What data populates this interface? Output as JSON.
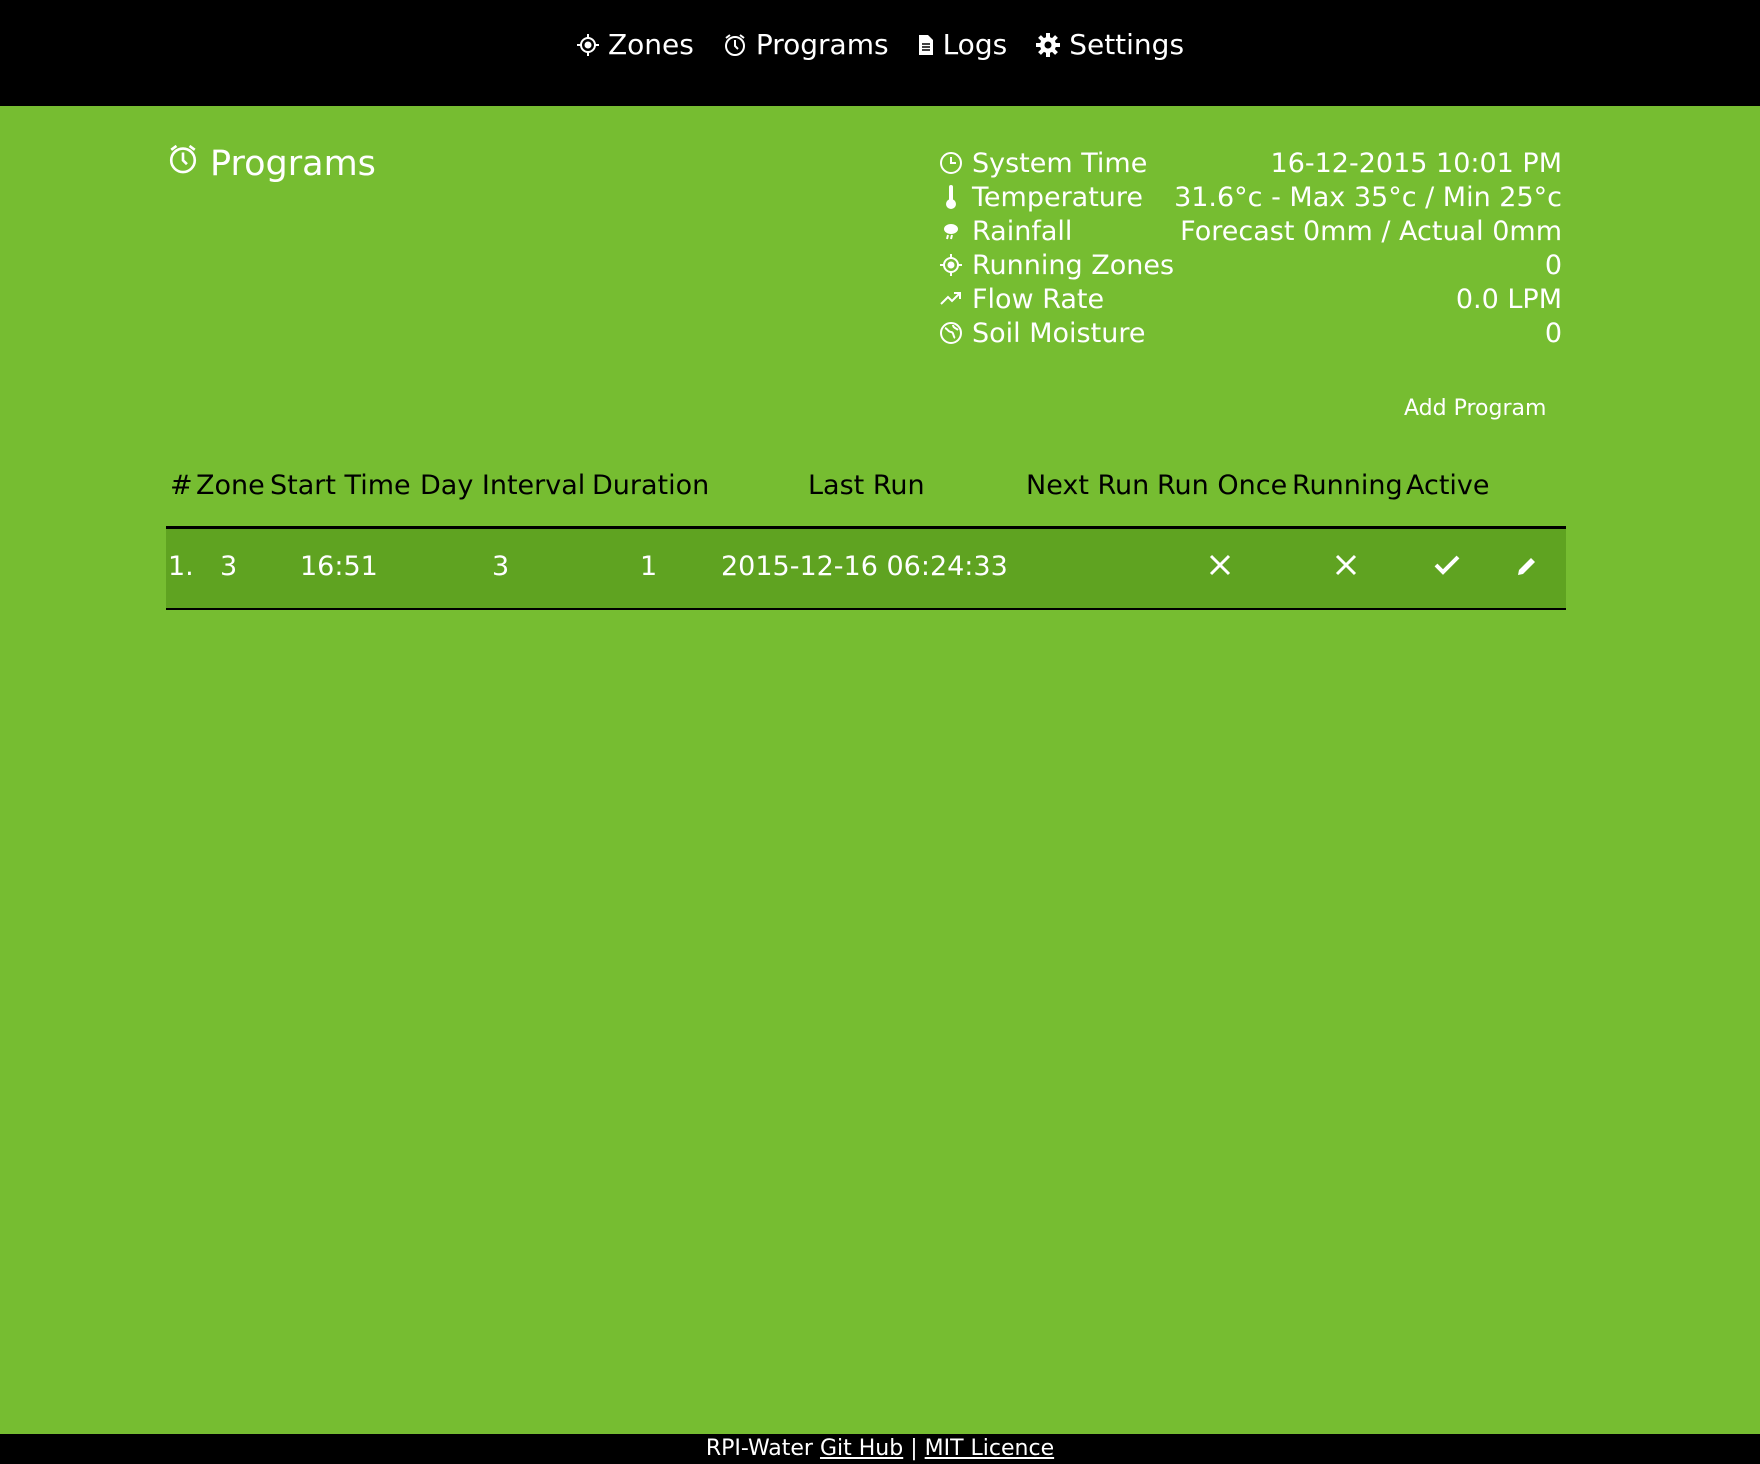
{
  "nav": {
    "items": [
      {
        "label": "Zones",
        "icon": "target-icon"
      },
      {
        "label": "Programs",
        "icon": "alarm-clock-icon"
      },
      {
        "label": "Logs",
        "icon": "file-icon"
      },
      {
        "label": "Settings",
        "icon": "gear-icon"
      }
    ]
  },
  "page": {
    "title": "Programs",
    "title_icon": "alarm-clock-icon"
  },
  "status": [
    {
      "label": "System Time",
      "value": "16-12-2015 10:01 PM",
      "icon": "clock-icon"
    },
    {
      "label": "Temperature",
      "value": "31.6°c - Max 35°c / Min 25°c",
      "icon": "thermometer-icon"
    },
    {
      "label": "Rainfall",
      "value": "Forecast 0mm / Actual 0mm",
      "icon": "rain-icon"
    },
    {
      "label": "Running Zones",
      "value": "0",
      "icon": "target-icon"
    },
    {
      "label": "Flow Rate",
      "value": "0.0 LPM",
      "icon": "trend-up-icon"
    },
    {
      "label": "Soil Moisture",
      "value": "0",
      "icon": "globe-icon"
    }
  ],
  "actions": {
    "add_program": "Add Program"
  },
  "table": {
    "headers": [
      "#",
      "Zone",
      "Start Time",
      "Day Interval",
      "Duration",
      "Last Run",
      "Next Run",
      "Run Once",
      "Running",
      "Active"
    ],
    "rows": [
      {
        "index": "1.",
        "zone": "3",
        "start_time": "16:51",
        "day_interval": "3",
        "duration": "1",
        "last_run": "2015-12-16 06:24:33",
        "next_run": "",
        "run_once": false,
        "running": false,
        "active": true,
        "edit_icon": "pencil-icon"
      }
    ]
  },
  "footer": {
    "app_name": "RPI-Water",
    "github_label": "Git Hub",
    "separator": "|",
    "licence_label": "MIT Licence"
  },
  "colors": {
    "background": "#76bd31",
    "row_background": "#5fa321",
    "bar": "#000000",
    "text": "#ffffff"
  }
}
